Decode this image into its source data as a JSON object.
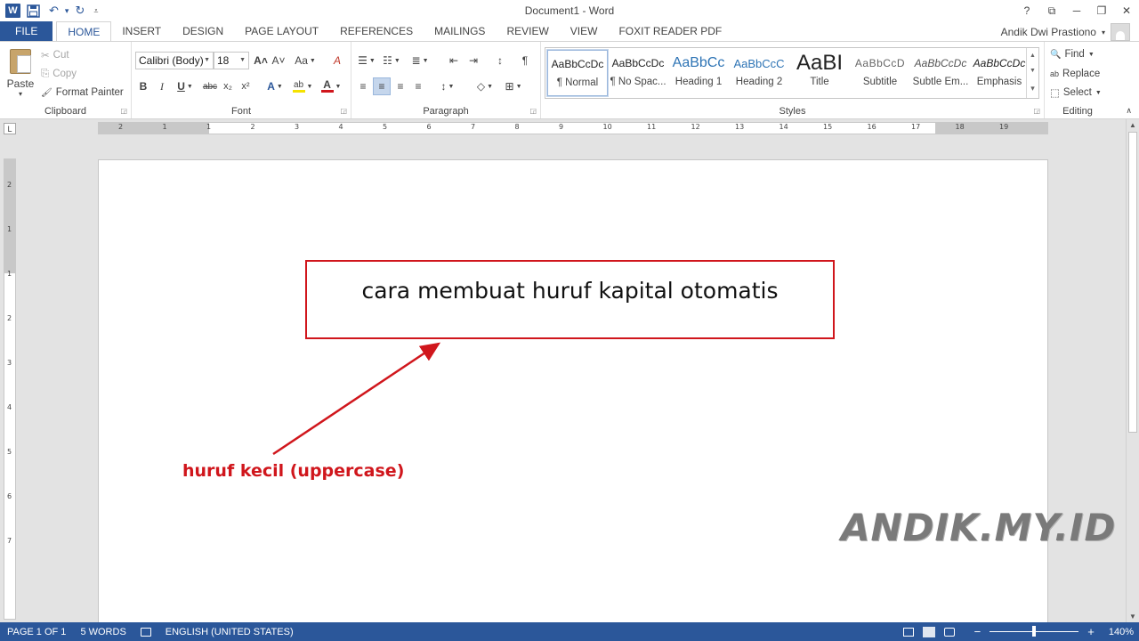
{
  "window": {
    "title": "Document1 - Word",
    "controls": {
      "help": "?",
      "ribbon_display": "⧉",
      "minimize": "─",
      "restore": "❐",
      "close": "✕"
    }
  },
  "quick_access": {
    "word_logo": "W",
    "save": "💾",
    "undo": "↶",
    "undo_arrow": "▾",
    "redo": "↻",
    "customize": "⩡"
  },
  "tabs": {
    "file": "FILE",
    "items": [
      "HOME",
      "INSERT",
      "DESIGN",
      "PAGE LAYOUT",
      "REFERENCES",
      "MAILINGS",
      "REVIEW",
      "VIEW",
      "FOXIT READER PDF"
    ],
    "active": "HOME"
  },
  "user": {
    "name": "Andik Dwi Prastiono",
    "dropdown": "▾"
  },
  "ribbon": {
    "clipboard": {
      "label": "Clipboard",
      "paste": "Paste",
      "paste_arrow": "▾",
      "cut": "Cut",
      "copy": "Copy",
      "format_painter": "Format Painter",
      "cut_icon": "✂",
      "copy_icon": "⎘",
      "painter_icon": "🖌"
    },
    "font": {
      "label": "Font",
      "font_name": "Calibri (Body)",
      "font_size": "18",
      "grow": "A˄",
      "shrink": "A˅",
      "change_case": "Aa",
      "clear_format": "A",
      "bold": "B",
      "italic": "I",
      "underline": "U",
      "strikethrough": "abc",
      "subscript": "x₂",
      "superscript": "x²",
      "text_effects": "A",
      "highlight": "ab",
      "font_color": "A"
    },
    "paragraph": {
      "label": "Paragraph",
      "bullets": "☰",
      "numbering": "☷",
      "multilevel": "≣",
      "decrease_indent": "⇤",
      "increase_indent": "⇥",
      "sort": "↕",
      "show_marks": "¶",
      "align_left": "≡",
      "center": "≡",
      "align_right": "≡",
      "justify": "≡",
      "line_spacing": "↕",
      "shading": "◇",
      "borders": "⊞"
    },
    "styles": {
      "label": "Styles",
      "items": [
        {
          "sample": "AaBbCcDc",
          "name": "¶ Normal"
        },
        {
          "sample": "AaBbCcDc",
          "name": "¶ No Spac..."
        },
        {
          "sample": "AaBbCc",
          "name": "Heading 1"
        },
        {
          "sample": "AaBbCcC",
          "name": "Heading 2"
        },
        {
          "sample": "AaBI",
          "name": "Title"
        },
        {
          "sample": "AaBbCcD",
          "name": "Subtitle"
        },
        {
          "sample": "AaBbCcDc",
          "name": "Subtle Em..."
        },
        {
          "sample": "AaBbCcDc",
          "name": "Emphasis"
        }
      ],
      "selected": "¶ Normal",
      "scroll_up": "▲",
      "scroll_down": "▼",
      "more": "▾"
    },
    "editing": {
      "label": "Editing",
      "find": "Find",
      "replace": "Replace",
      "select": "Select",
      "find_icon": "🔍",
      "replace_icon": "ab",
      "select_icon": "⬚"
    },
    "collapse": "∧"
  },
  "ruler": {
    "corner": "L",
    "numbers": [
      "2",
      "1",
      "1",
      "2",
      "3",
      "4",
      "5",
      "6",
      "7",
      "8",
      "9",
      "10",
      "11",
      "12",
      "13",
      "14",
      "15",
      "16",
      "17",
      "18",
      "19"
    ],
    "vertical_numbers": [
      "2",
      "1",
      "1",
      "2",
      "3",
      "4",
      "5",
      "6",
      "7"
    ]
  },
  "document": {
    "box_text": "cara membuat huruf kapital otomatis",
    "annotation": "huruf kecil (uppercase)",
    "watermark": "ANDIK.MY.ID"
  },
  "status": {
    "page": "PAGE 1 OF 1",
    "words": "5 WORDS",
    "proofing_icon": "📖",
    "language": "ENGLISH (UNITED STATES)",
    "zoom": "140%",
    "zoom_minus": "−",
    "zoom_plus": "+",
    "zoom_level": 0.5
  },
  "colors": {
    "accent": "#2b579a",
    "annotation_red": "#d0161c",
    "font_color_bar": "#d0161c",
    "highlight_bar": "#f5e200"
  }
}
